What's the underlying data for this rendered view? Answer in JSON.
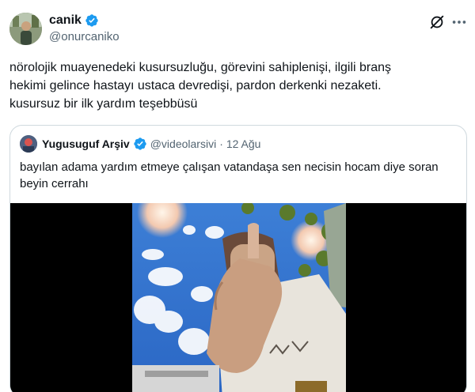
{
  "author": {
    "display_name": "canik",
    "handle": "@onurcaniko",
    "verified": true
  },
  "tweet": {
    "text": "nörolojik muayenedeki kusursuzluğu, görevini sahiplenişi, ilgili branş\nhekimi gelince hastayı ustaca devredişi, pardon derkenki nezaketi.\nkusursuz bir ilk yardım teşebbüsü"
  },
  "quoted": {
    "display_name": "Yugusuguf Arşiv",
    "handle": "@videolarsivi",
    "separator": "·",
    "date": "12 Ağu",
    "verified": true,
    "text": "bayılan adama yardım etmeye çalışan vatandaşa sen necisin hocam diye soran beyin cerrahı"
  },
  "icons": {
    "verified": "verified-badge-icon",
    "grok": "grok-icon",
    "more": "more-icon"
  },
  "colors": {
    "verified_blue": "#1d9bf0",
    "text_primary": "#0f1419",
    "text_secondary": "#536471",
    "border": "#cfd9de"
  }
}
